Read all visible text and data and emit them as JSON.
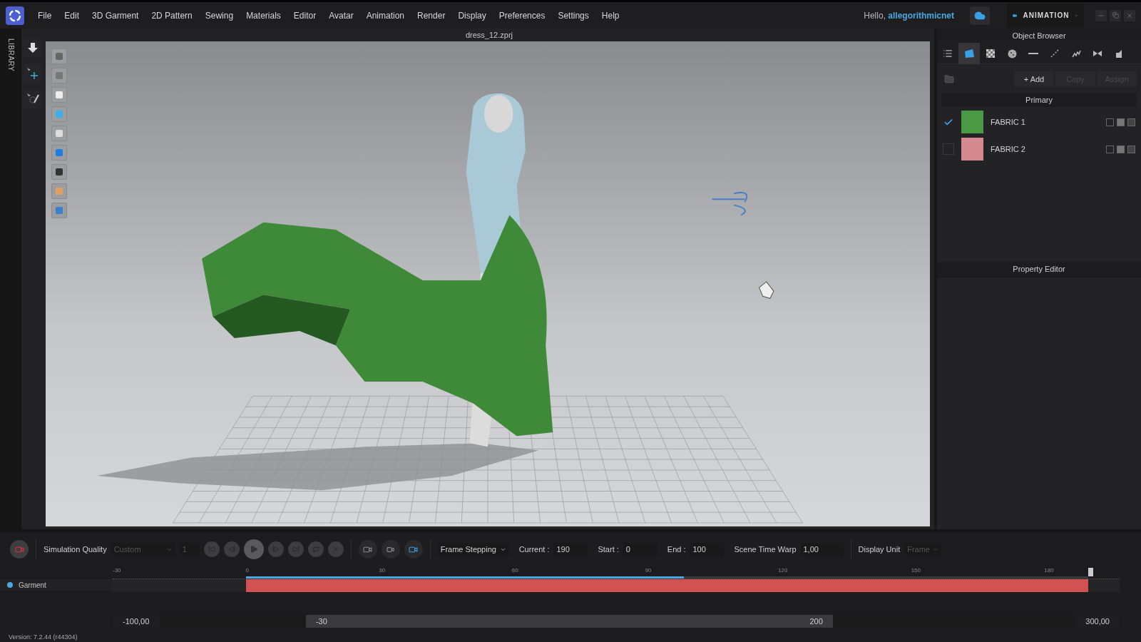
{
  "menu_bar": {
    "items": [
      "File",
      "Edit",
      "3D Garment",
      "2D Pattern",
      "Sewing",
      "Materials",
      "Editor",
      "Avatar",
      "Animation",
      "Render",
      "Display",
      "Preferences",
      "Settings",
      "Help"
    ]
  },
  "user": {
    "greeting": "Hello,",
    "name": "allegorithmicnet"
  },
  "workspace": {
    "label": "ANIMATION"
  },
  "library_tab": {
    "label": "LIBRARY"
  },
  "viewport": {
    "title": "dress_12.zprj"
  },
  "object_browser": {
    "title": "Object Browser",
    "tabs": [
      {
        "kind": "list",
        "selected": false
      },
      {
        "kind": "garment",
        "selected": true
      },
      {
        "kind": "fabric",
        "selected": false
      },
      {
        "kind": "button",
        "selected": false
      },
      {
        "kind": "line",
        "selected": false
      },
      {
        "kind": "stitch",
        "selected": false
      },
      {
        "kind": "zigzag",
        "selected": false
      },
      {
        "kind": "bow",
        "selected": false
      },
      {
        "kind": "more",
        "selected": false
      }
    ],
    "buttons": [
      {
        "label": "+ Add",
        "disabled": false
      },
      {
        "label": "Copy",
        "disabled": true
      },
      {
        "label": "Assign",
        "disabled": true
      }
    ],
    "group": "Primary",
    "fabrics": [
      {
        "name": "FABRIC 1",
        "color": "#4a9a45",
        "checked": true
      },
      {
        "name": "FABRIC 2",
        "color": "#d48890",
        "checked": false
      }
    ]
  },
  "property_editor": {
    "title": "Property Editor"
  },
  "controls": {
    "simulation_quality": {
      "label": "Simulation Quality",
      "value": "Custom",
      "disabled": true
    },
    "step": {
      "value": "1",
      "disabled": true
    },
    "frame_stepping": {
      "value": "Frame Stepping"
    },
    "fields": [
      {
        "label": "Current :",
        "value": "190"
      },
      {
        "label": "Start :",
        "value": "0"
      },
      {
        "label": "End :",
        "value": "100"
      }
    ],
    "time_warp": {
      "label": "Scene Time Warp",
      "value": "1,00"
    },
    "display_unit": {
      "label": "Display Unit",
      "value": "Frame",
      "disabled": true
    }
  },
  "timeline": {
    "ruler_labels": [
      "-30",
      "0",
      "30",
      "60",
      "90",
      "120",
      "150",
      "180"
    ],
    "tracks": [
      {
        "name": "Garment",
        "color": "#4aa8e0"
      }
    ],
    "cache": {
      "level": 0.52
    },
    "range": {
      "min": "-100,00",
      "start": "-30",
      "end": "200",
      "max": "300,00"
    }
  },
  "status_bar": {
    "version": "Version: 7.2.44 (r44304)"
  }
}
